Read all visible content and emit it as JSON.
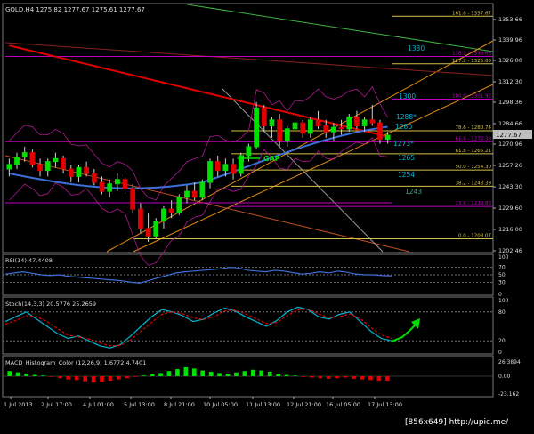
{
  "symbol_header": "GOLD,H4  1275.82 1277.67 1275.61 1277.67",
  "price_axis_ticks": [
    "1353.66",
    "1339.96",
    "1326.00",
    "1312.30",
    "1298.36",
    "1284.66",
    "1270.96",
    "1257.26",
    "1243.30",
    "1229.60",
    "1216.00",
    "1202.46"
  ],
  "current_price": "1277.67",
  "fib_labels": [
    "161.8 - 1357.67",
    "138.2 - 1330.66",
    "127.2 - 1325.68",
    "100.0 - 1301.92",
    "78.6 - 1280.74",
    "61.8 - 1273.38",
    "61.8 - 1265.21",
    "50.0 - 1254.30",
    "38.2 - 1243.39",
    "23.6 - 1229.83",
    "0.0 - 1208.07"
  ],
  "level_labels": [
    "1330",
    "1300",
    "1288*",
    "1280",
    "1273*",
    "1265",
    "1254",
    "1243"
  ],
  "gap_label": "GAP",
  "rsi": {
    "label": "RSI(14) 47.4408",
    "axis": [
      "100",
      "70",
      "50",
      "30",
      "0"
    ]
  },
  "stoch": {
    "label": "Stoch(14,3,3) 20.5776 25.2659",
    "axis": [
      "100",
      "80",
      "20",
      "0"
    ]
  },
  "macd": {
    "label": "MACD_Histogram_Color (12,26,9)  1.6772  4.7401",
    "axis": [
      "26.3894",
      "0.00",
      "-23.162"
    ]
  },
  "time_axis": [
    "1 Jul 2013",
    "2 Jul 17:00",
    "4 Jul 01:00",
    "5 Jul 13:00",
    "8 Jul 21:00",
    "10 Jul 05:00",
    "11 Jul 13:00",
    "12 Jul 21:00",
    "16 Jul 05:00",
    "17 Jul 13:00"
  ],
  "watermark": "[856x649] http://upic.me/",
  "colors": {
    "bull": "#00e000",
    "bear": "#e00000",
    "fib": "#d4c24a",
    "magenta": "#c000c0",
    "ma_blue": "#3d6fd8",
    "ma_red": "#e00000",
    "orange": "#e08a10",
    "green_line": "#3fb23f",
    "cyan": "#00b4d2"
  },
  "chart_data": {
    "type": "candlestick",
    "title": "GOLD,H4",
    "ylim": [
      1200,
      1365
    ],
    "candles_ohlc": [
      [
        1255,
        1262,
        1250,
        1258
      ],
      [
        1258,
        1266,
        1255,
        1263
      ],
      [
        1263,
        1270,
        1260,
        1266
      ],
      [
        1266,
        1268,
        1256,
        1258
      ],
      [
        1258,
        1262,
        1250,
        1254
      ],
      [
        1254,
        1262,
        1250,
        1260
      ],
      [
        1260,
        1266,
        1256,
        1262
      ],
      [
        1262,
        1264,
        1252,
        1255
      ],
      [
        1255,
        1258,
        1246,
        1250
      ],
      [
        1250,
        1258,
        1246,
        1256
      ],
      [
        1256,
        1260,
        1250,
        1252
      ],
      [
        1252,
        1255,
        1244,
        1246
      ],
      [
        1246,
        1250,
        1238,
        1240
      ],
      [
        1240,
        1248,
        1236,
        1245
      ],
      [
        1245,
        1252,
        1240,
        1248
      ],
      [
        1248,
        1250,
        1238,
        1242
      ],
      [
        1242,
        1245,
        1225,
        1228
      ],
      [
        1228,
        1232,
        1212,
        1215
      ],
      [
        1215,
        1225,
        1206,
        1210
      ],
      [
        1210,
        1222,
        1208,
        1220
      ],
      [
        1220,
        1230,
        1215,
        1228
      ],
      [
        1228,
        1234,
        1222,
        1226
      ],
      [
        1226,
        1238,
        1224,
        1236
      ],
      [
        1236,
        1244,
        1232,
        1240
      ],
      [
        1240,
        1246,
        1234,
        1236
      ],
      [
        1236,
        1248,
        1234,
        1246
      ],
      [
        1246,
        1262,
        1242,
        1260
      ],
      [
        1260,
        1264,
        1250,
        1254
      ],
      [
        1254,
        1262,
        1250,
        1258
      ],
      [
        1258,
        1262,
        1248,
        1252
      ],
      [
        1252,
        1266,
        1250,
        1264
      ],
      [
        1264,
        1272,
        1260,
        1270
      ],
      [
        1270,
        1300,
        1268,
        1296
      ],
      [
        1296,
        1298,
        1280,
        1284
      ],
      [
        1284,
        1290,
        1276,
        1288
      ],
      [
        1288,
        1292,
        1270,
        1274
      ],
      [
        1274,
        1284,
        1270,
        1282
      ],
      [
        1282,
        1290,
        1278,
        1286
      ],
      [
        1286,
        1288,
        1276,
        1279
      ],
      [
        1279,
        1290,
        1276,
        1288
      ],
      [
        1288,
        1294,
        1282,
        1284
      ],
      [
        1284,
        1288,
        1276,
        1280
      ],
      [
        1280,
        1286,
        1274,
        1283
      ],
      [
        1283,
        1288,
        1278,
        1282
      ],
      [
        1282,
        1292,
        1280,
        1290
      ],
      [
        1290,
        1294,
        1282,
        1284
      ],
      [
        1284,
        1290,
        1280,
        1288
      ],
      [
        1288,
        1298,
        1284,
        1286
      ],
      [
        1286,
        1288,
        1272,
        1275
      ],
      [
        1275,
        1280,
        1272,
        1277.67
      ]
    ],
    "fibonacci_levels": [
      {
        "ratio": 161.8,
        "price": 1357.67
      },
      {
        "ratio": 138.2,
        "price": 1330.66
      },
      {
        "ratio": 127.2,
        "price": 1325.68
      },
      {
        "ratio": 100.0,
        "price": 1301.92
      },
      {
        "ratio": 78.6,
        "price": 1280.74
      },
      {
        "ratio": 61.8,
        "price": 1273.38
      },
      {
        "ratio": 61.8,
        "price": 1265.21
      },
      {
        "ratio": 50.0,
        "price": 1254.3
      },
      {
        "ratio": 38.2,
        "price": 1243.39
      },
      {
        "ratio": 23.6,
        "price": 1229.83
      },
      {
        "ratio": 0.0,
        "price": 1208.07
      }
    ],
    "rsi": [
      52,
      55,
      58,
      54,
      50,
      48,
      50,
      46,
      44,
      42,
      40,
      38,
      36,
      34,
      30,
      28,
      35,
      42,
      48,
      55,
      58,
      60,
      62,
      64,
      66,
      70,
      68,
      62,
      60,
      58,
      62,
      60,
      56,
      52,
      54,
      58,
      55,
      60,
      57,
      52,
      50,
      50,
      48,
      47
    ],
    "stoch_k": [
      60,
      70,
      80,
      65,
      50,
      35,
      25,
      30,
      20,
      10,
      5,
      12,
      30,
      50,
      70,
      85,
      80,
      72,
      60,
      65,
      78,
      88,
      82,
      70,
      60,
      50,
      62,
      80,
      90,
      85,
      70,
      65,
      75,
      80,
      60,
      40,
      25,
      20
    ],
    "stoch_d": [
      55,
      62,
      72,
      70,
      60,
      45,
      32,
      28,
      24,
      16,
      10,
      10,
      22,
      40,
      58,
      75,
      80,
      76,
      68,
      64,
      70,
      82,
      84,
      76,
      66,
      56,
      58,
      72,
      84,
      86,
      76,
      68,
      70,
      76,
      66,
      48,
      32,
      25
    ],
    "macd_hist": [
      8,
      6,
      4,
      2,
      1,
      -1,
      -3,
      -5,
      -6,
      -8,
      -10,
      -9,
      -7,
      -5,
      -3,
      -1,
      1,
      3,
      5,
      8,
      11,
      14,
      12,
      9,
      7,
      5,
      4,
      6,
      8,
      10,
      9,
      7,
      4,
      2,
      1,
      -1,
      -2,
      -3,
      -4,
      -3,
      -2,
      -4,
      -5,
      -6,
      -7,
      -7
    ]
  }
}
